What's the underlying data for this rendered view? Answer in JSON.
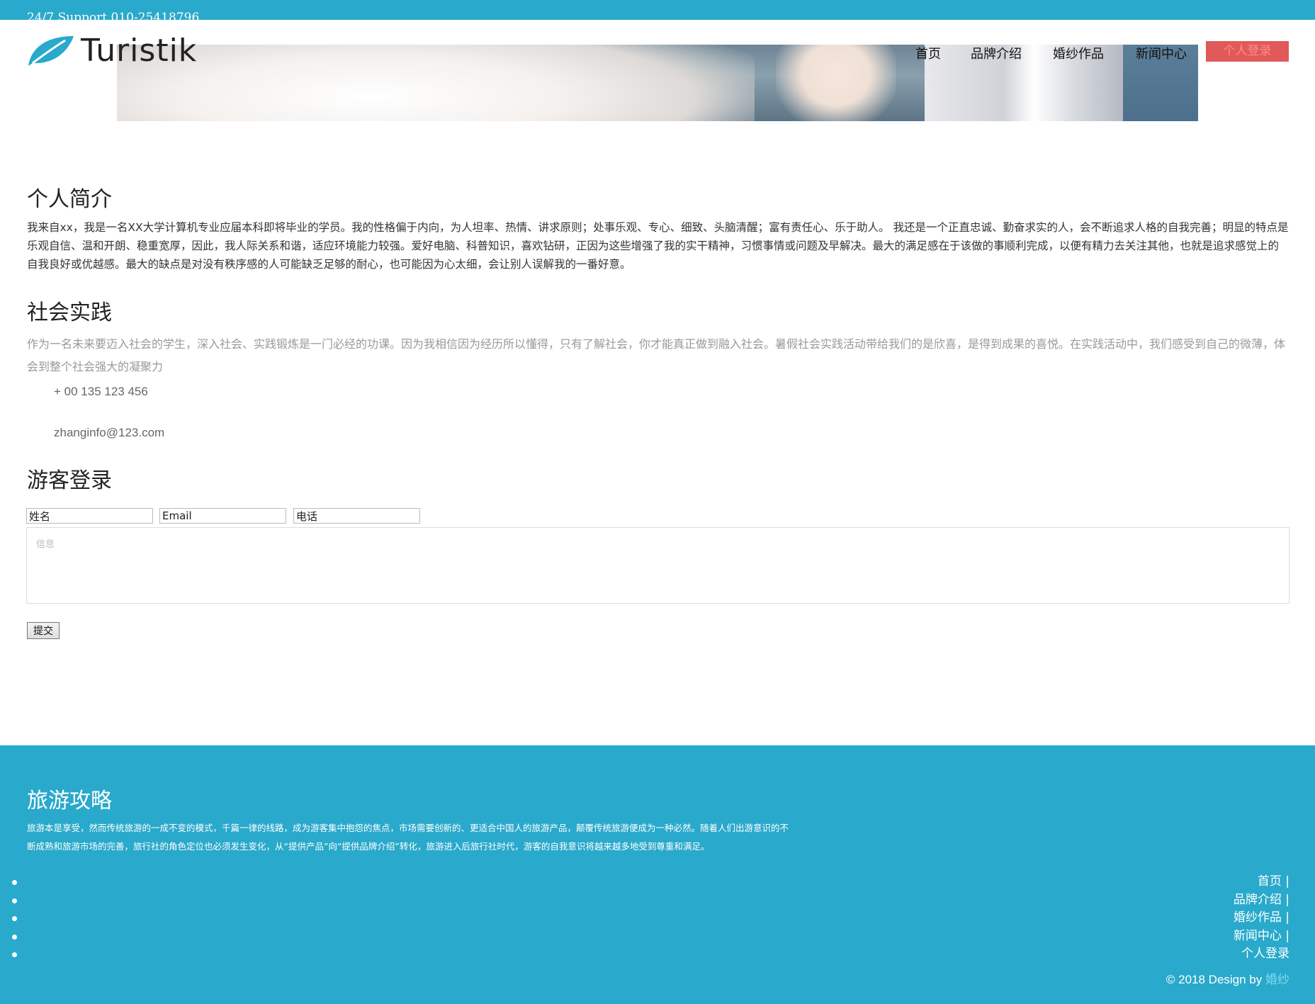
{
  "topbar": {
    "support": "24/7 Support 010-25418796"
  },
  "logo": {
    "name": "Turistik"
  },
  "nav": {
    "items": [
      "首页",
      "品牌介绍",
      "婚纱作品",
      "新闻中心"
    ],
    "login": "个人登录"
  },
  "intro": {
    "title": "个人简介",
    "text": "我来自xx，我是一名XX大学计算机专业应届本科即将毕业的学员。我的性格偏于内向，为人坦率、热情、讲求原则；处事乐观、专心、细致、头脑清醒；富有责任心、乐于助人。 我还是一个正直忠诚、勤奋求实的人，会不断追求人格的自我完善；明显的特点是乐观自信、温和开朗、稳重宽厚，因此，我人际关系和谐，适应环境能力较强。爱好电脑、科普知识，喜欢钻研，正因为这些增强了我的实干精神，习惯事情或问题及早解决。最大的满足感在于该做的事顺利完成，以便有精力去关注其他，也就是追求感觉上的自我良好或优越感。最大的缺点是对没有秩序感的人可能缺乏足够的耐心，也可能因为心太细，会让别人误解我的一番好意。"
  },
  "practice": {
    "title": "社会实践",
    "text": "作为一名未来要迈入社会的学生，深入社会、实践锻炼是一门必经的功课。因为我相信因为经历所以懂得，只有了解社会，你才能真正做到融入社会。暑假社会实践活动带给我们的是欣喜，是得到成果的喜悦。在实践活动中，我们感受到自己的微薄，体会到整个社会强大的凝聚力",
    "phone": "+ 00 135 123 456",
    "email": "zhanginfo@123.com"
  },
  "guest": {
    "title": "游客登录",
    "name_value": "姓名",
    "email_value": "Email",
    "phone_value": "电话",
    "message_placeholder": "信息",
    "submit": "提交"
  },
  "footer": {
    "title": "旅游攻略",
    "text": "旅游本是享受，然而传统旅游的一成不变的模式，千篇一律的线路，成为游客集中抱怨的焦点，市场需要创新的、更适合中国人的旅游产品，颠覆传统旅游便成为一种必然。随着人们出游意识的不断成熟和旅游市场的完善，旅行社的角色定位也必须发生变化，从“提供产品”向“提供品牌介绍”转化，旅游进入后旅行社时代，游客的自我意识将越来越多地受到尊重和满足。",
    "links": [
      "首页 |",
      "品牌介绍 |",
      "婚纱作品 |",
      "新闻中心 |",
      "个人登录"
    ],
    "copyright": "© 2018 Design by",
    "brand": "婚纱"
  },
  "colors": {
    "accent": "#29a9cb",
    "login_button": "#e05a5a",
    "muted_text": "#999999"
  }
}
